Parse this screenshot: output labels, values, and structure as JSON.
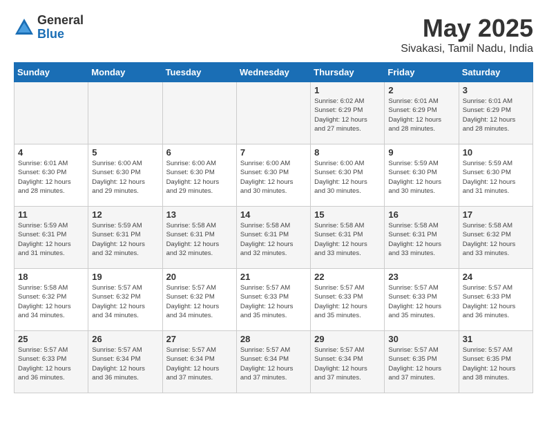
{
  "logo": {
    "general": "General",
    "blue": "Blue"
  },
  "title": {
    "month": "May 2025",
    "location": "Sivakasi, Tamil Nadu, India"
  },
  "days_of_week": [
    "Sunday",
    "Monday",
    "Tuesday",
    "Wednesday",
    "Thursday",
    "Friday",
    "Saturday"
  ],
  "weeks": [
    [
      {
        "day": "",
        "info": ""
      },
      {
        "day": "",
        "info": ""
      },
      {
        "day": "",
        "info": ""
      },
      {
        "day": "",
        "info": ""
      },
      {
        "day": "1",
        "info": "Sunrise: 6:02 AM\nSunset: 6:29 PM\nDaylight: 12 hours\nand 27 minutes."
      },
      {
        "day": "2",
        "info": "Sunrise: 6:01 AM\nSunset: 6:29 PM\nDaylight: 12 hours\nand 28 minutes."
      },
      {
        "day": "3",
        "info": "Sunrise: 6:01 AM\nSunset: 6:29 PM\nDaylight: 12 hours\nand 28 minutes."
      }
    ],
    [
      {
        "day": "4",
        "info": "Sunrise: 6:01 AM\nSunset: 6:30 PM\nDaylight: 12 hours\nand 28 minutes."
      },
      {
        "day": "5",
        "info": "Sunrise: 6:00 AM\nSunset: 6:30 PM\nDaylight: 12 hours\nand 29 minutes."
      },
      {
        "day": "6",
        "info": "Sunrise: 6:00 AM\nSunset: 6:30 PM\nDaylight: 12 hours\nand 29 minutes."
      },
      {
        "day": "7",
        "info": "Sunrise: 6:00 AM\nSunset: 6:30 PM\nDaylight: 12 hours\nand 30 minutes."
      },
      {
        "day": "8",
        "info": "Sunrise: 6:00 AM\nSunset: 6:30 PM\nDaylight: 12 hours\nand 30 minutes."
      },
      {
        "day": "9",
        "info": "Sunrise: 5:59 AM\nSunset: 6:30 PM\nDaylight: 12 hours\nand 30 minutes."
      },
      {
        "day": "10",
        "info": "Sunrise: 5:59 AM\nSunset: 6:30 PM\nDaylight: 12 hours\nand 31 minutes."
      }
    ],
    [
      {
        "day": "11",
        "info": "Sunrise: 5:59 AM\nSunset: 6:31 PM\nDaylight: 12 hours\nand 31 minutes."
      },
      {
        "day": "12",
        "info": "Sunrise: 5:59 AM\nSunset: 6:31 PM\nDaylight: 12 hours\nand 32 minutes."
      },
      {
        "day": "13",
        "info": "Sunrise: 5:58 AM\nSunset: 6:31 PM\nDaylight: 12 hours\nand 32 minutes."
      },
      {
        "day": "14",
        "info": "Sunrise: 5:58 AM\nSunset: 6:31 PM\nDaylight: 12 hours\nand 32 minutes."
      },
      {
        "day": "15",
        "info": "Sunrise: 5:58 AM\nSunset: 6:31 PM\nDaylight: 12 hours\nand 33 minutes."
      },
      {
        "day": "16",
        "info": "Sunrise: 5:58 AM\nSunset: 6:31 PM\nDaylight: 12 hours\nand 33 minutes."
      },
      {
        "day": "17",
        "info": "Sunrise: 5:58 AM\nSunset: 6:32 PM\nDaylight: 12 hours\nand 33 minutes."
      }
    ],
    [
      {
        "day": "18",
        "info": "Sunrise: 5:58 AM\nSunset: 6:32 PM\nDaylight: 12 hours\nand 34 minutes."
      },
      {
        "day": "19",
        "info": "Sunrise: 5:57 AM\nSunset: 6:32 PM\nDaylight: 12 hours\nand 34 minutes."
      },
      {
        "day": "20",
        "info": "Sunrise: 5:57 AM\nSunset: 6:32 PM\nDaylight: 12 hours\nand 34 minutes."
      },
      {
        "day": "21",
        "info": "Sunrise: 5:57 AM\nSunset: 6:33 PM\nDaylight: 12 hours\nand 35 minutes."
      },
      {
        "day": "22",
        "info": "Sunrise: 5:57 AM\nSunset: 6:33 PM\nDaylight: 12 hours\nand 35 minutes."
      },
      {
        "day": "23",
        "info": "Sunrise: 5:57 AM\nSunset: 6:33 PM\nDaylight: 12 hours\nand 35 minutes."
      },
      {
        "day": "24",
        "info": "Sunrise: 5:57 AM\nSunset: 6:33 PM\nDaylight: 12 hours\nand 36 minutes."
      }
    ],
    [
      {
        "day": "25",
        "info": "Sunrise: 5:57 AM\nSunset: 6:33 PM\nDaylight: 12 hours\nand 36 minutes."
      },
      {
        "day": "26",
        "info": "Sunrise: 5:57 AM\nSunset: 6:34 PM\nDaylight: 12 hours\nand 36 minutes."
      },
      {
        "day": "27",
        "info": "Sunrise: 5:57 AM\nSunset: 6:34 PM\nDaylight: 12 hours\nand 37 minutes."
      },
      {
        "day": "28",
        "info": "Sunrise: 5:57 AM\nSunset: 6:34 PM\nDaylight: 12 hours\nand 37 minutes."
      },
      {
        "day": "29",
        "info": "Sunrise: 5:57 AM\nSunset: 6:34 PM\nDaylight: 12 hours\nand 37 minutes."
      },
      {
        "day": "30",
        "info": "Sunrise: 5:57 AM\nSunset: 6:35 PM\nDaylight: 12 hours\nand 37 minutes."
      },
      {
        "day": "31",
        "info": "Sunrise: 5:57 AM\nSunset: 6:35 PM\nDaylight: 12 hours\nand 38 minutes."
      }
    ]
  ]
}
